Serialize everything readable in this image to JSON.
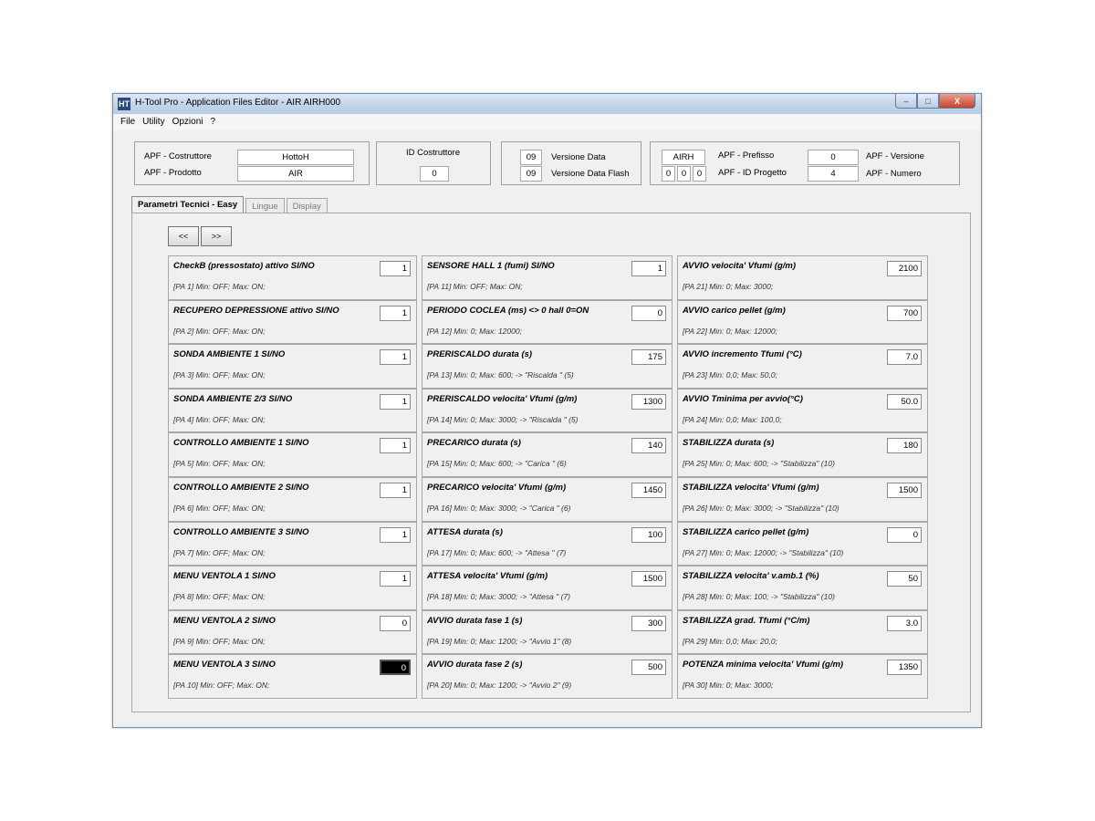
{
  "window": {
    "title": "H-Tool Pro - Application Files Editor - AIR AIRH000",
    "app_icon": "HT",
    "controls": {
      "minimize": "–",
      "maximize": "□",
      "close": "X"
    }
  },
  "menu": [
    "File",
    "Utility",
    "Opzioni",
    "?"
  ],
  "header": {
    "costruttore_label": "APF - Costruttore",
    "costruttore_value": "HottoH",
    "prodotto_label": "APF - Prodotto",
    "prodotto_value": "AIR",
    "id_costruttore_label": "ID Costruttore",
    "id_costruttore_value": "0",
    "versione_data_value": "09",
    "versione_data_label": "Versione Data",
    "versione_data_flash_value": "09",
    "versione_data_flash_label": "Versione Data Flash",
    "prefisso_value": "AIRH",
    "prefisso_label": "APF - Prefisso",
    "id_progetto_values": [
      "0",
      "0",
      "0"
    ],
    "id_progetto_label": "APF - ID Progetto",
    "versione_value": "0",
    "versione_label": "APF - Versione",
    "numero_value": "4",
    "numero_label": "APF - Numero"
  },
  "tabs": [
    {
      "label": "Parametri Tecnici - Easy",
      "active": true
    },
    {
      "label": "Lingue",
      "active": false
    },
    {
      "label": "Display",
      "active": false
    }
  ],
  "nav": {
    "prev": "<<",
    "next": ">>"
  },
  "params": [
    {
      "name": "CheckB  (pressostato) attivo SI/NO",
      "range": "[PA 1] Min: OFF; Max: ON;",
      "value": "1"
    },
    {
      "name": "SENSORE HALL 1 (fumi) SI/NO",
      "range": "[PA 11] Min: OFF; Max: ON;",
      "value": "1"
    },
    {
      "name": "AVVIO velocita' Vfumi (g/m)",
      "range": "[PA 21] Min: 0; Max: 3000;",
      "value": "2100"
    },
    {
      "name": "RECUPERO DEPRESSIONE attivo SI/NO",
      "range": "[PA 2] Min: OFF; Max: ON;",
      "value": "1"
    },
    {
      "name": "PERIODO COCLEA (ms) <> 0 hall 0=ON",
      "range": "[PA 12] Min: 0; Max: 12000;",
      "value": "0"
    },
    {
      "name": "AVVIO carico pellet (g/m)",
      "range": "[PA 22] Min: 0; Max: 12000;",
      "value": "700"
    },
    {
      "name": "SONDA AMBIENTE 1 SI/NO",
      "range": "[PA 3] Min: OFF; Max: ON;",
      "value": "1"
    },
    {
      "name": "PRERISCALDO durata (s)",
      "range": "[PA 13] Min: 0; Max: 600; -> \"Riscalda \" (5)",
      "value": "175"
    },
    {
      "name": "AVVIO incremento Tfumi (°C)",
      "range": "[PA 23] Min: 0,0; Max: 50,0;",
      "value": "7.0"
    },
    {
      "name": "SONDA AMBIENTE 2/3 SI/NO",
      "range": "[PA 4] Min: OFF; Max: ON;",
      "value": "1"
    },
    {
      "name": "PRERISCALDO velocita' Vfumi (g/m)",
      "range": "[PA 14] Min: 0; Max: 3000; -> \"Riscalda \" (5)",
      "value": "1300"
    },
    {
      "name": "AVVIO Tminima per avvio(°C)",
      "range": "[PA 24] Min: 0,0; Max: 100,0;",
      "value": "50.0"
    },
    {
      "name": "CONTROLLO AMBIENTE 1 SI/NO",
      "range": "[PA 5] Min: OFF; Max: ON;",
      "value": "1"
    },
    {
      "name": "PRECARICO durata (s)",
      "range": "[PA 15] Min: 0; Max: 600; -> \"Carica \" (6)",
      "value": "140"
    },
    {
      "name": "STABILIZZA durata (s)",
      "range": "[PA 25] Min: 0; Max: 600; -> \"Stabilizza\" (10)",
      "value": "180"
    },
    {
      "name": "CONTROLLO AMBIENTE 2 SI/NO",
      "range": "[PA 6] Min: OFF; Max: ON;",
      "value": "1"
    },
    {
      "name": "PRECARICO velocita' Vfumi (g/m)",
      "range": "[PA 16] Min: 0; Max: 3000; -> \"Carica \" (6)",
      "value": "1450"
    },
    {
      "name": "STABILIZZA velocita' Vfumi (g/m)",
      "range": "[PA 26] Min: 0; Max: 3000; -> \"Stabilizza\" (10)",
      "value": "1500"
    },
    {
      "name": "CONTROLLO AMBIENTE 3 SI/NO",
      "range": "[PA 7] Min: OFF; Max: ON;",
      "value": "1"
    },
    {
      "name": "ATTESA durata (s)",
      "range": "[PA 17] Min: 0; Max: 600; -> \"Attesa \" (7)",
      "value": "100"
    },
    {
      "name": "STABILIZZA carico pellet (g/m)",
      "range": "[PA 27] Min: 0; Max: 12000; -> \"Stabilizza\" (10)",
      "value": "0"
    },
    {
      "name": "MENU VENTOLA 1 SI/NO",
      "range": "[PA 8] Min: OFF; Max: ON;",
      "value": "1"
    },
    {
      "name": "ATTESA velocita' Vfumi (g/m)",
      "range": "[PA 18] Min: 0; Max: 3000; -> \"Attesa \" (7)",
      "value": "1500"
    },
    {
      "name": "STABILIZZA velocita' v.amb.1 (%)",
      "range": "[PA 28] Min: 0; Max: 100; -> \"Stabilizza\" (10)",
      "value": "50"
    },
    {
      "name": "MENU VENTOLA 2 SI/NO",
      "range": "[PA 9] Min: OFF; Max: ON;",
      "value": "0"
    },
    {
      "name": "AVVIO durata fase 1 (s)",
      "range": "[PA 19] Min: 0; Max: 1200; -> \"Avvio 1\" (8)",
      "value": "300"
    },
    {
      "name": "STABILIZZA grad. Tfumi (°C/m)",
      "range": "[PA 29] Min: 0,0; Max: 20,0;",
      "value": "3.0"
    },
    {
      "name": "MENU VENTOLA 3 SI/NO",
      "range": "[PA 10] Min: OFF; Max: ON;",
      "value": "0",
      "selected": true
    },
    {
      "name": "AVVIO durata fase 2 (s)",
      "range": "[PA 20] Min: 0; Max: 1200; -> \"Avvio 2\" (9)",
      "value": "500"
    },
    {
      "name": "POTENZA minima velocita' Vfumi (g/m)",
      "range": "[PA 30] Min: 0; Max: 3000;",
      "value": "1350"
    }
  ]
}
